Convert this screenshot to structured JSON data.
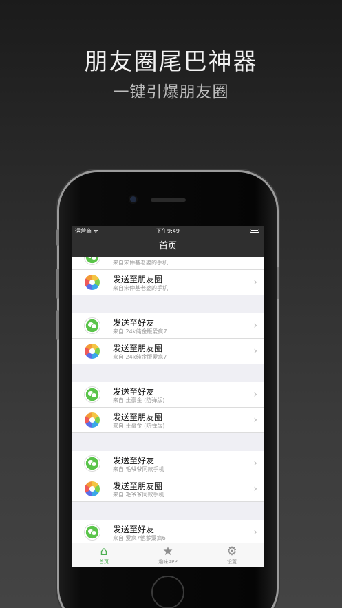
{
  "promo": {
    "headline": "朋友圈尾巴神器",
    "subline": "一键引爆朋友圈"
  },
  "status_bar": {
    "carrier": "运营商 ᯤ",
    "time": "下午9:49"
  },
  "nav": {
    "title": "首页"
  },
  "rows": [
    {
      "icon": "wechat-icon",
      "title": "",
      "subtitle": "来自宋仲基老婆的手机"
    },
    {
      "icon": "moments-icon",
      "title": "发送至朋友圈",
      "subtitle": "来自宋仲基老婆的手机"
    },
    {
      "icon": "wechat-icon",
      "title": "发送至好友",
      "subtitle": "来自 24k纯金版爱疯7"
    },
    {
      "icon": "moments-icon",
      "title": "发送至朋友圈",
      "subtitle": "来自 24k纯金版爱疯7"
    },
    {
      "icon": "wechat-icon",
      "title": "发送至好友",
      "subtitle": "来自 土豪金 (防弹版)"
    },
    {
      "icon": "moments-icon",
      "title": "发送至朋友圈",
      "subtitle": "来自 土豪金 (防弹版)"
    },
    {
      "icon": "wechat-icon",
      "title": "发送至好友",
      "subtitle": "来自 毛爷爷同款手机"
    },
    {
      "icon": "moments-icon",
      "title": "发送至朋友圈",
      "subtitle": "来自 毛爷爷同款手机"
    },
    {
      "icon": "wechat-icon",
      "title": "发送至好友",
      "subtitle": "来自 爱疯7他爹爱疯6"
    }
  ],
  "chevron": "›",
  "tabs": [
    {
      "label": "首页",
      "icon": "home-icon",
      "glyph": "⌂",
      "active": true
    },
    {
      "label": "趣味APP",
      "icon": "star-icon",
      "glyph": "★",
      "active": false
    },
    {
      "label": "设置",
      "icon": "gear-icon",
      "glyph": "⚙",
      "active": false
    }
  ],
  "colors": {
    "accent": "#4caf50",
    "nav_bg": "#2f2f2f",
    "list_bg": "#efeff4"
  }
}
